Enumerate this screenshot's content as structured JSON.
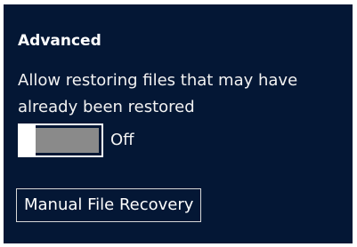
{
  "section": {
    "title": "Advanced"
  },
  "setting": {
    "description": "Allow restoring files that may have already been restored",
    "toggle": {
      "state_label": "Off",
      "is_on": false
    }
  },
  "actions": {
    "manual_recovery_label": "Manual File Recovery"
  },
  "colors": {
    "panel_background": "#041735",
    "text": "#ffffff",
    "toggle_track": "#8a8a8a",
    "toggle_thumb": "#ffffff"
  }
}
